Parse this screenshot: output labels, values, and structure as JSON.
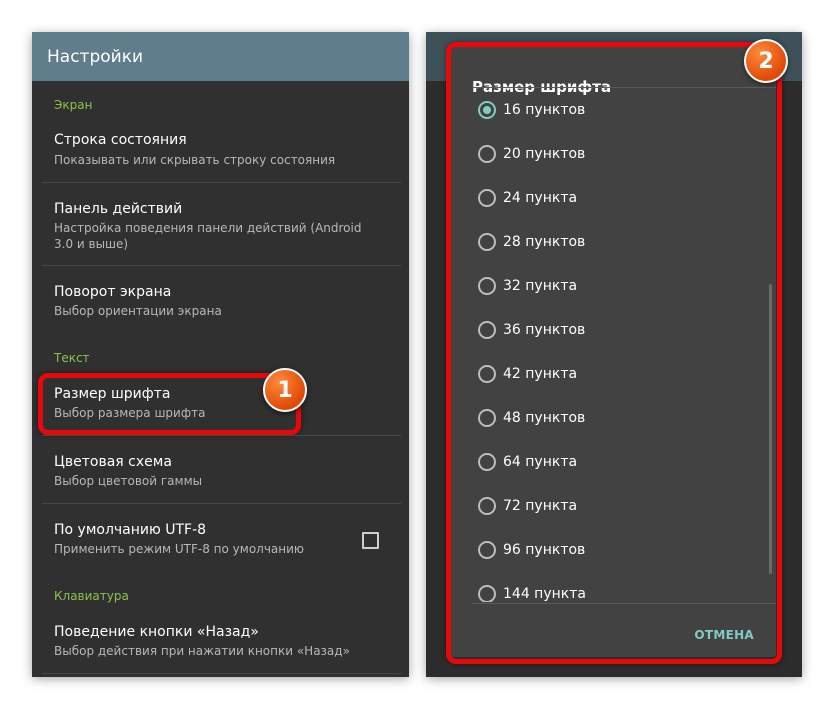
{
  "left_screen": {
    "appbar_title": "Настройки",
    "sections": {
      "screen": "Экран",
      "text": "Текст",
      "keyboard": "Клавиатура"
    },
    "items": [
      {
        "title": "Строка состояния",
        "summary": "Показывать или скрывать строку состояния"
      },
      {
        "title": "Панель действий",
        "summary": "Настройка поведения панели действий (Android 3.0 и выше)"
      },
      {
        "title": "Поворот экрана",
        "summary": "Выбор ориентации экрана"
      },
      {
        "title": "Размер шрифта",
        "summary": "Выбор размера шрифта"
      },
      {
        "title": "Цветовая схема",
        "summary": "Выбор цветовой гаммы"
      },
      {
        "title": "По умолчанию UTF-8",
        "summary": "Применить режим UTF-8 по умолчанию",
        "checked": false
      },
      {
        "title": "Поведение кнопки «Назад»",
        "summary": "Выбор действия при нажатии кнопки «Назад»"
      }
    ],
    "callout_number": "1"
  },
  "right_screen": {
    "dialog_title": "Размер шрифта",
    "options": [
      {
        "label": "16 пунктов",
        "selected": true
      },
      {
        "label": "20 пунктов",
        "selected": false
      },
      {
        "label": "24 пункта",
        "selected": false
      },
      {
        "label": "28 пунктов",
        "selected": false
      },
      {
        "label": "32 пункта",
        "selected": false
      },
      {
        "label": "36 пунктов",
        "selected": false
      },
      {
        "label": "42 пункта",
        "selected": false
      },
      {
        "label": "48 пунктов",
        "selected": false
      },
      {
        "label": "64 пункта",
        "selected": false
      },
      {
        "label": "72 пункта",
        "selected": false
      },
      {
        "label": "96 пунктов",
        "selected": false
      },
      {
        "label": "144 пункта",
        "selected": false
      }
    ],
    "cancel_label": "ОТМЕНА",
    "callout_number": "2"
  },
  "colors": {
    "accent_green": "#8bc34a",
    "accent_teal": "#80cbc4",
    "appbar": "#607d8b",
    "highlight_red": "#e8070b",
    "badge_orange": "#f06a14"
  }
}
